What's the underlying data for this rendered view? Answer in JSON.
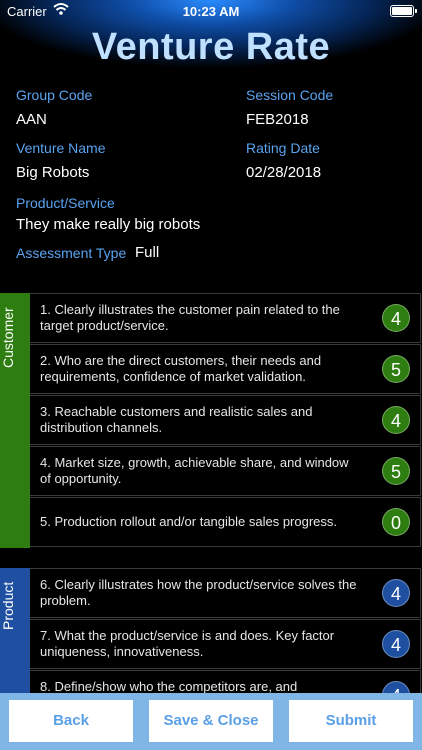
{
  "status": {
    "carrier": "Carrier",
    "time": "10:23 AM"
  },
  "app": {
    "title": "Venture Rate"
  },
  "info": {
    "group_code_label": "Group Code",
    "group_code": "AAN",
    "session_code_label": "Session Code",
    "session_code": "FEB2018",
    "venture_name_label": "Venture Name",
    "venture_name": "Big Robots",
    "rating_date_label": "Rating Date",
    "rating_date": "02/28/2018",
    "product_service_label": "Product/Service",
    "product_service": "They make really big robots",
    "assessment_type_label": "Assessment Type",
    "assessment_type": "Full"
  },
  "sections": {
    "customer": {
      "label": "Customer",
      "color": "#2e7d10",
      "items": [
        {
          "text": "1. Clearly illustrates the customer pain related to the target product/service.",
          "score": "4"
        },
        {
          "text": "2. Who are the direct customers, their needs and requirements, confidence of market validation.",
          "score": "5"
        },
        {
          "text": "3. Reachable customers and realistic sales and distribution channels.",
          "score": "4"
        },
        {
          "text": "4. Market size, growth, achievable share, and window of opportunity.",
          "score": "5"
        },
        {
          "text": "5. Production rollout and/or tangible sales progress.",
          "score": "0"
        }
      ]
    },
    "product": {
      "label": "Product",
      "color": "#1e4fa0",
      "items": [
        {
          "text": "6. Clearly illustrates how the product/service solves the problem.",
          "score": "4"
        },
        {
          "text": "7. What the product/service is and does. Key factor uniqueness, innovativeness.",
          "score": "4"
        },
        {
          "text": "8. Define/show who the competitors are, and",
          "score": "4"
        }
      ]
    }
  },
  "footer": {
    "back": "Back",
    "save_close": "Save & Close",
    "submit": "Submit"
  }
}
